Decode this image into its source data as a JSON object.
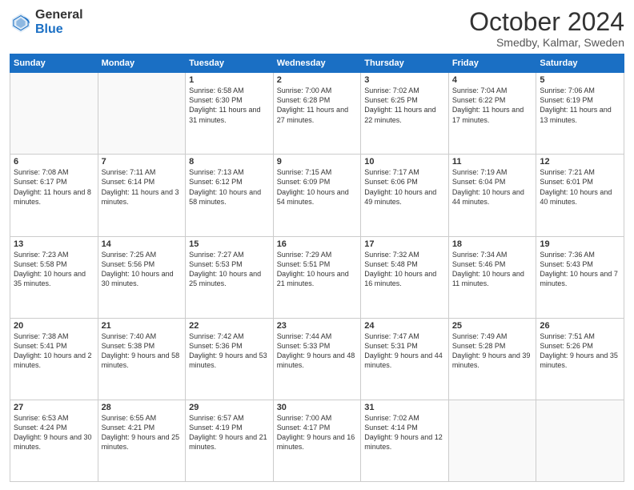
{
  "logo": {
    "line1": "General",
    "line2": "Blue"
  },
  "title": "October 2024",
  "subtitle": "Smedby, Kalmar, Sweden",
  "days": [
    "Sunday",
    "Monday",
    "Tuesday",
    "Wednesday",
    "Thursday",
    "Friday",
    "Saturday"
  ],
  "weeks": [
    [
      {
        "day": "",
        "content": ""
      },
      {
        "day": "",
        "content": ""
      },
      {
        "day": "1",
        "content": "Sunrise: 6:58 AM\nSunset: 6:30 PM\nDaylight: 11 hours and 31 minutes."
      },
      {
        "day": "2",
        "content": "Sunrise: 7:00 AM\nSunset: 6:28 PM\nDaylight: 11 hours and 27 minutes."
      },
      {
        "day": "3",
        "content": "Sunrise: 7:02 AM\nSunset: 6:25 PM\nDaylight: 11 hours and 22 minutes."
      },
      {
        "day": "4",
        "content": "Sunrise: 7:04 AM\nSunset: 6:22 PM\nDaylight: 11 hours and 17 minutes."
      },
      {
        "day": "5",
        "content": "Sunrise: 7:06 AM\nSunset: 6:19 PM\nDaylight: 11 hours and 13 minutes."
      }
    ],
    [
      {
        "day": "6",
        "content": "Sunrise: 7:08 AM\nSunset: 6:17 PM\nDaylight: 11 hours and 8 minutes."
      },
      {
        "day": "7",
        "content": "Sunrise: 7:11 AM\nSunset: 6:14 PM\nDaylight: 11 hours and 3 minutes."
      },
      {
        "day": "8",
        "content": "Sunrise: 7:13 AM\nSunset: 6:12 PM\nDaylight: 10 hours and 58 minutes."
      },
      {
        "day": "9",
        "content": "Sunrise: 7:15 AM\nSunset: 6:09 PM\nDaylight: 10 hours and 54 minutes."
      },
      {
        "day": "10",
        "content": "Sunrise: 7:17 AM\nSunset: 6:06 PM\nDaylight: 10 hours and 49 minutes."
      },
      {
        "day": "11",
        "content": "Sunrise: 7:19 AM\nSunset: 6:04 PM\nDaylight: 10 hours and 44 minutes."
      },
      {
        "day": "12",
        "content": "Sunrise: 7:21 AM\nSunset: 6:01 PM\nDaylight: 10 hours and 40 minutes."
      }
    ],
    [
      {
        "day": "13",
        "content": "Sunrise: 7:23 AM\nSunset: 5:58 PM\nDaylight: 10 hours and 35 minutes."
      },
      {
        "day": "14",
        "content": "Sunrise: 7:25 AM\nSunset: 5:56 PM\nDaylight: 10 hours and 30 minutes."
      },
      {
        "day": "15",
        "content": "Sunrise: 7:27 AM\nSunset: 5:53 PM\nDaylight: 10 hours and 25 minutes."
      },
      {
        "day": "16",
        "content": "Sunrise: 7:29 AM\nSunset: 5:51 PM\nDaylight: 10 hours and 21 minutes."
      },
      {
        "day": "17",
        "content": "Sunrise: 7:32 AM\nSunset: 5:48 PM\nDaylight: 10 hours and 16 minutes."
      },
      {
        "day": "18",
        "content": "Sunrise: 7:34 AM\nSunset: 5:46 PM\nDaylight: 10 hours and 11 minutes."
      },
      {
        "day": "19",
        "content": "Sunrise: 7:36 AM\nSunset: 5:43 PM\nDaylight: 10 hours and 7 minutes."
      }
    ],
    [
      {
        "day": "20",
        "content": "Sunrise: 7:38 AM\nSunset: 5:41 PM\nDaylight: 10 hours and 2 minutes."
      },
      {
        "day": "21",
        "content": "Sunrise: 7:40 AM\nSunset: 5:38 PM\nDaylight: 9 hours and 58 minutes."
      },
      {
        "day": "22",
        "content": "Sunrise: 7:42 AM\nSunset: 5:36 PM\nDaylight: 9 hours and 53 minutes."
      },
      {
        "day": "23",
        "content": "Sunrise: 7:44 AM\nSunset: 5:33 PM\nDaylight: 9 hours and 48 minutes."
      },
      {
        "day": "24",
        "content": "Sunrise: 7:47 AM\nSunset: 5:31 PM\nDaylight: 9 hours and 44 minutes."
      },
      {
        "day": "25",
        "content": "Sunrise: 7:49 AM\nSunset: 5:28 PM\nDaylight: 9 hours and 39 minutes."
      },
      {
        "day": "26",
        "content": "Sunrise: 7:51 AM\nSunset: 5:26 PM\nDaylight: 9 hours and 35 minutes."
      }
    ],
    [
      {
        "day": "27",
        "content": "Sunrise: 6:53 AM\nSunset: 4:24 PM\nDaylight: 9 hours and 30 minutes."
      },
      {
        "day": "28",
        "content": "Sunrise: 6:55 AM\nSunset: 4:21 PM\nDaylight: 9 hours and 25 minutes."
      },
      {
        "day": "29",
        "content": "Sunrise: 6:57 AM\nSunset: 4:19 PM\nDaylight: 9 hours and 21 minutes."
      },
      {
        "day": "30",
        "content": "Sunrise: 7:00 AM\nSunset: 4:17 PM\nDaylight: 9 hours and 16 minutes."
      },
      {
        "day": "31",
        "content": "Sunrise: 7:02 AM\nSunset: 4:14 PM\nDaylight: 9 hours and 12 minutes."
      },
      {
        "day": "",
        "content": ""
      },
      {
        "day": "",
        "content": ""
      }
    ]
  ]
}
